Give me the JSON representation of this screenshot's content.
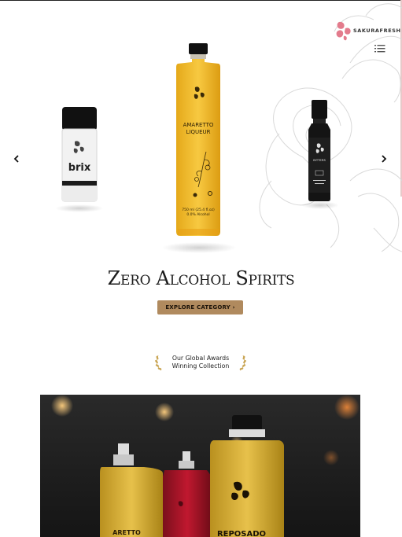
{
  "brand": {
    "name": "SAKURAFRESH",
    "accent": "#e37b8c"
  },
  "nav": {
    "menu_icon": "hamburger-menu-icon"
  },
  "carousel": {
    "prev_icon": "chevron-left-icon",
    "next_icon": "chevron-right-icon",
    "products": [
      {
        "name": "brix",
        "label": "brix"
      },
      {
        "name": "amaretto",
        "label_line1": "AMARETTO",
        "label_line2": "LIQUEUR",
        "volume_line1": "750 ml (25.4 fl.oz)",
        "volume_line2": "0.0% Alcohol"
      },
      {
        "name": "bitters",
        "label": "BITTERS"
      }
    ]
  },
  "headline": "Zero Alcohol Spirits",
  "cta": {
    "label": "EXPLORE CATEGORY ›",
    "color": "#b08a5e"
  },
  "awards": {
    "line1": "Our Global Awards",
    "line2": "Winning Collection"
  },
  "hero": {
    "bottle_label": "REPOSADO",
    "bottle_label_left": "ARETTO"
  }
}
